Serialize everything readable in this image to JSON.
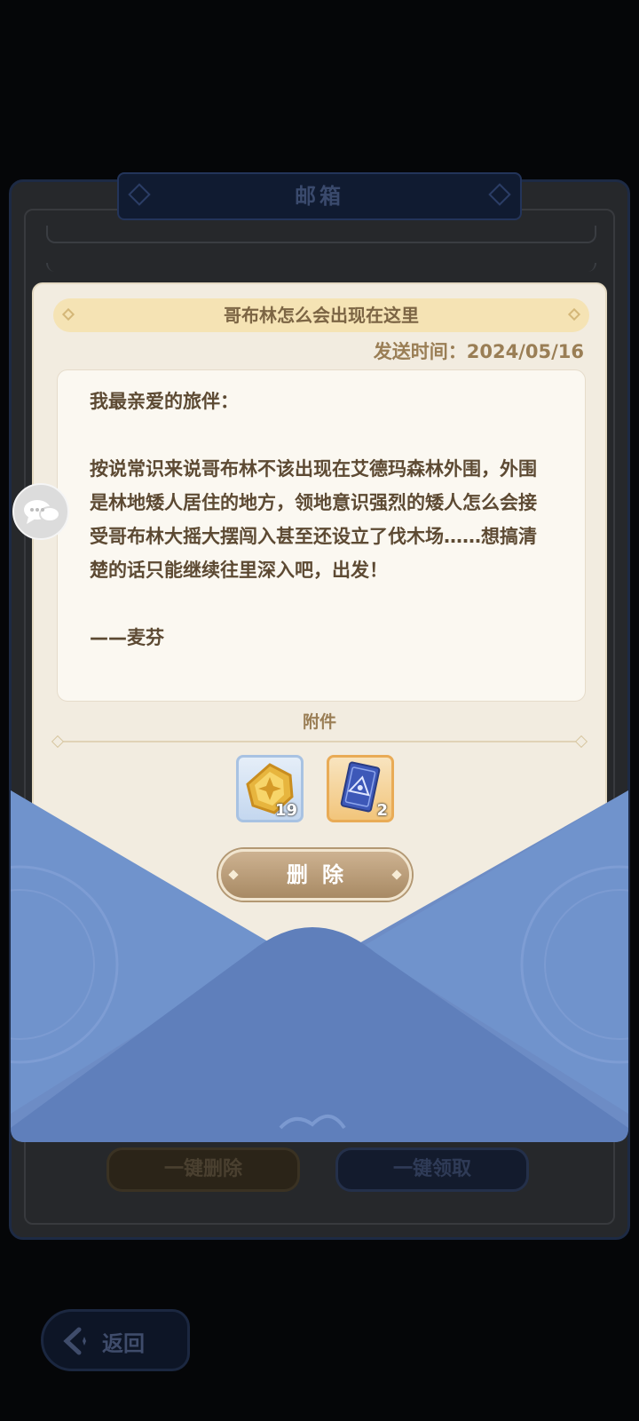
{
  "mailbox": {
    "title": "邮箱",
    "delete_all_label": "一键删除",
    "claim_all_label": "一键领取"
  },
  "letter": {
    "subject": "哥布林怎么会出现在这里",
    "send_time": "发送时间：2024/05/16",
    "greeting": "我最亲爱的旅伴：",
    "body": "按说常识来说哥布林不该出现在艾德玛森林外围，外围是林地矮人居住的地方，领地意识强烈的矮人怎么会接受哥布林大摇大摆闯入甚至还设立了伐木场……想搞清楚的话只能继续往里深入吧，出发！",
    "signature": "——麦芬",
    "attachments_label": "附件",
    "attachments": [
      {
        "icon": "gold-coin-icon",
        "count": "19"
      },
      {
        "icon": "eye-card-icon",
        "count": "2"
      }
    ],
    "delete_label": "删除"
  },
  "back_label": "返回",
  "colors": {
    "paper": "#f2ece0",
    "envelope": "#6f8ec6",
    "button_brown": "#b89b76",
    "text_brown": "#5d4a33"
  }
}
